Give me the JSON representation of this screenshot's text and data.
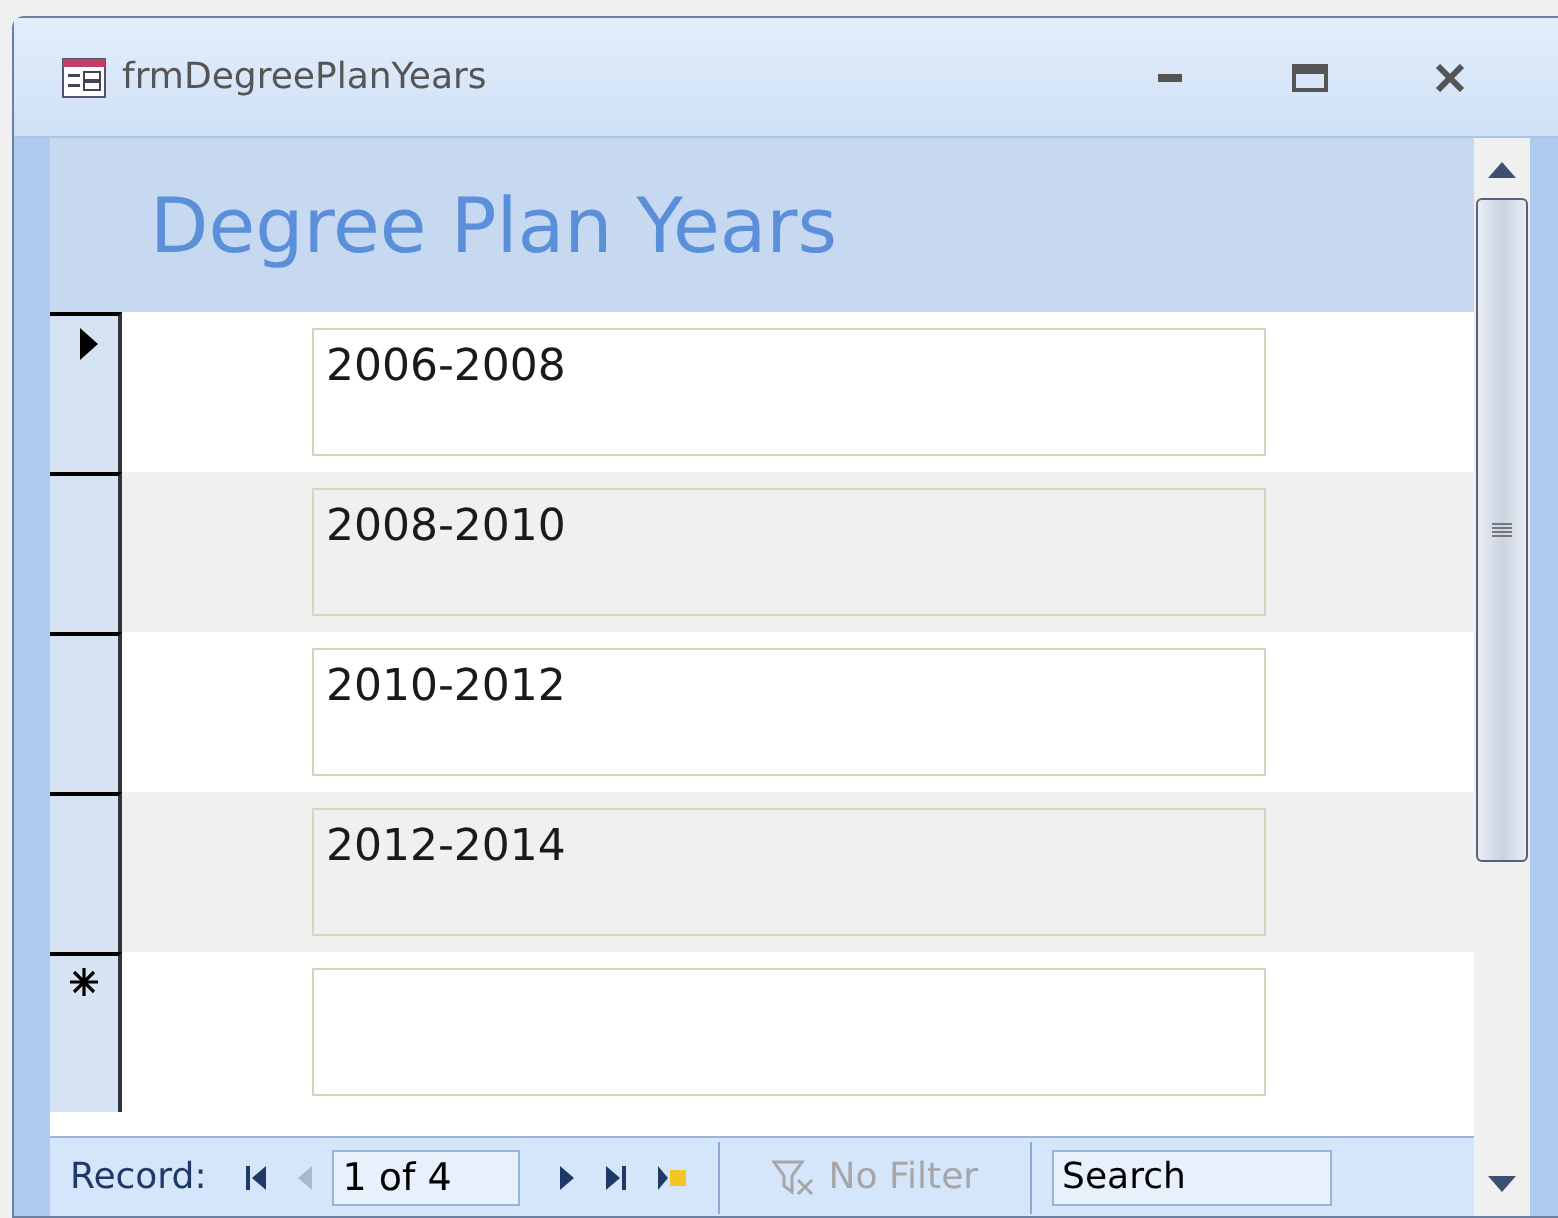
{
  "window": {
    "title": "frmDegreePlanYears"
  },
  "header": {
    "title": "Degree Plan Years"
  },
  "records": [
    {
      "kind": "current",
      "value": "2006-2008"
    },
    {
      "kind": "plain",
      "value": "2008-2010"
    },
    {
      "kind": "plain",
      "value": "2010-2012"
    },
    {
      "kind": "plain",
      "value": "2012-2014"
    },
    {
      "kind": "new"
    }
  ],
  "navigation": {
    "label": "Record:",
    "position": "1 of 4",
    "buttons": [
      {
        "kind": "first",
        "disabled": false
      },
      {
        "kind": "prev",
        "disabled": true
      },
      {
        "kind": "next",
        "disabled": false
      },
      {
        "kind": "last",
        "disabled": false
      },
      {
        "kind": "new",
        "disabled": false
      }
    ],
    "filter": {
      "label": "No Filter",
      "disabled": true
    },
    "search": {
      "placeholder": "Search"
    }
  }
}
